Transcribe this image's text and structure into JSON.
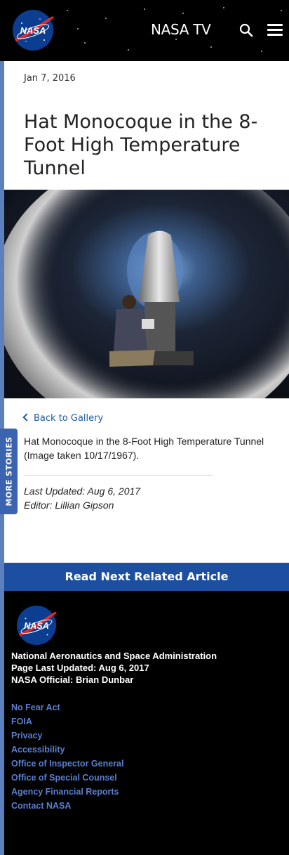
{
  "header": {
    "logo_text": "NASA",
    "nasa_tv_label": "NASA TV"
  },
  "sidebar": {
    "more_stories_label": "MORE STORIES"
  },
  "article": {
    "date": "Jan 7, 2016",
    "title": "Hat Monocoque in the 8-Foot High Temperature Tunnel",
    "back_label": "Back to Gallery",
    "caption": "Hat Monocoque in the 8-Foot High Temperature Tunnel (Image taken 10/17/1967).",
    "last_updated": "Last Updated: Aug 6, 2017",
    "editor": "Editor: Lillian Gipson"
  },
  "next_article_label": "Read Next Related Article",
  "footer": {
    "logo_text": "NASA",
    "org_name": "National Aeronautics and Space Administration",
    "page_updated": "Page Last Updated: Aug 6, 2017",
    "official": "NASA Official: Brian Dunbar",
    "links": [
      "No Fear Act",
      "FOIA",
      "Privacy",
      "Accessibility",
      "Office of Inspector General",
      "Office of Special Counsel",
      "Agency Financial Reports",
      "Contact NASA"
    ]
  },
  "colors": {
    "header_bg": "#000000",
    "accent_blue": "#1c4fa0",
    "link_blue": "#1f5aa6",
    "footer_link": "#5a7fd0",
    "nasa_red": "#e22b2b",
    "nasa_blue": "#0b3d91"
  },
  "icons": [
    "nasa-logo-icon",
    "search-icon",
    "menu-icon",
    "chevron-left-icon"
  ]
}
